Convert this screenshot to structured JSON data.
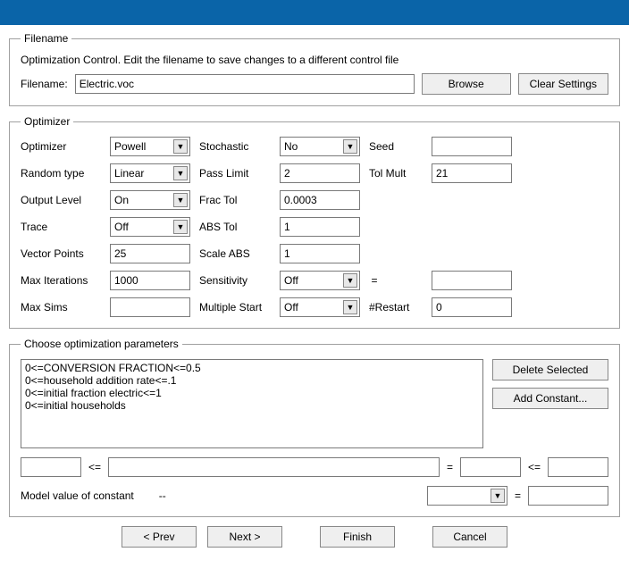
{
  "filename_group": {
    "legend": "Filename",
    "description": "Optimization Control.  Edit the filename to save changes to a different control file",
    "label": "Filename:",
    "value": "Electric.voc",
    "browse": "Browse",
    "clear": "Clear Settings"
  },
  "optimizer_group": {
    "legend": "Optimizer",
    "rows": {
      "optimizer": {
        "label": "Optimizer",
        "value": "Powell"
      },
      "stochastic": {
        "label": "Stochastic",
        "value": "No"
      },
      "seed": {
        "label": "Seed",
        "value": ""
      },
      "random_type": {
        "label": "Random type",
        "value": "Linear"
      },
      "pass_limit": {
        "label": "Pass Limit",
        "value": "2"
      },
      "tol_mult": {
        "label": "Tol Mult",
        "value": "21"
      },
      "output_level": {
        "label": "Output Level",
        "value": "On"
      },
      "frac_tol": {
        "label": "Frac Tol",
        "value": "0.0003"
      },
      "trace": {
        "label": "Trace",
        "value": "Off"
      },
      "abs_tol": {
        "label": "ABS Tol",
        "value": "1"
      },
      "vector_points": {
        "label": "Vector Points",
        "value": "25"
      },
      "scale_abs": {
        "label": "Scale ABS",
        "value": "1"
      },
      "max_iter": {
        "label": "Max Iterations",
        "value": "1000"
      },
      "sensitivity": {
        "label": "Sensitivity",
        "value": "Off",
        "eq": "=",
        "rhs": ""
      },
      "max_sims": {
        "label": "Max Sims",
        "value": ""
      },
      "multi_start": {
        "label": "Multiple Start",
        "value": "Off",
        "restart_label": "#Restart",
        "restart_value": "0"
      }
    }
  },
  "params_group": {
    "legend": "Choose optimization parameters",
    "items": [
      "0<=CONVERSION FRACTION<=0.5",
      "0<=household addition rate<=.1",
      "0<=initial fraction electric<=1",
      "0<=initial households"
    ],
    "delete": "Delete Selected",
    "add": "Add Constant...",
    "le": "<=",
    "eq": "=",
    "model_label": "Model value of constant",
    "model_value": "--"
  },
  "wizard": {
    "prev": "< Prev",
    "next": "Next >",
    "finish": "Finish",
    "cancel": "Cancel"
  }
}
